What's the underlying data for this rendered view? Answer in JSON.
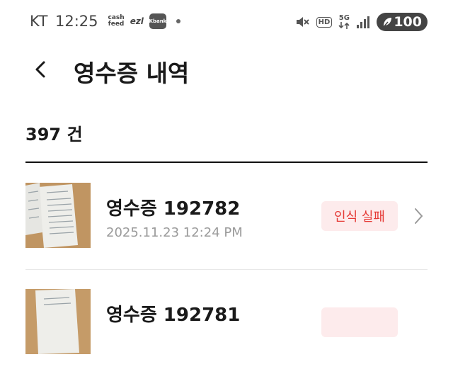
{
  "status_bar": {
    "carrier": "KT",
    "time": "12:25",
    "app_icons": {
      "cashfeed": "cash\nfeed",
      "ezl": "ezl",
      "kbank": "Kbank"
    },
    "battery": "100",
    "icons": [
      "mute-icon",
      "hd-voice-icon",
      "5g-icon",
      "signal-icon",
      "battery-icon"
    ],
    "hd_label": "HD",
    "fiveg_label": "5G"
  },
  "header": {
    "title": "영수증 내역"
  },
  "list": {
    "count": "397 건",
    "items": [
      {
        "title": "영수증 192782",
        "date": "2025.11.23 12:24 PM",
        "status": "인식 실패"
      },
      {
        "title": "영수증 192781",
        "date": "",
        "status": ""
      }
    ]
  },
  "colors": {
    "badge_bg": "#fdebec",
    "badge_text": "#e53935",
    "date_text": "#9a9a9a"
  }
}
